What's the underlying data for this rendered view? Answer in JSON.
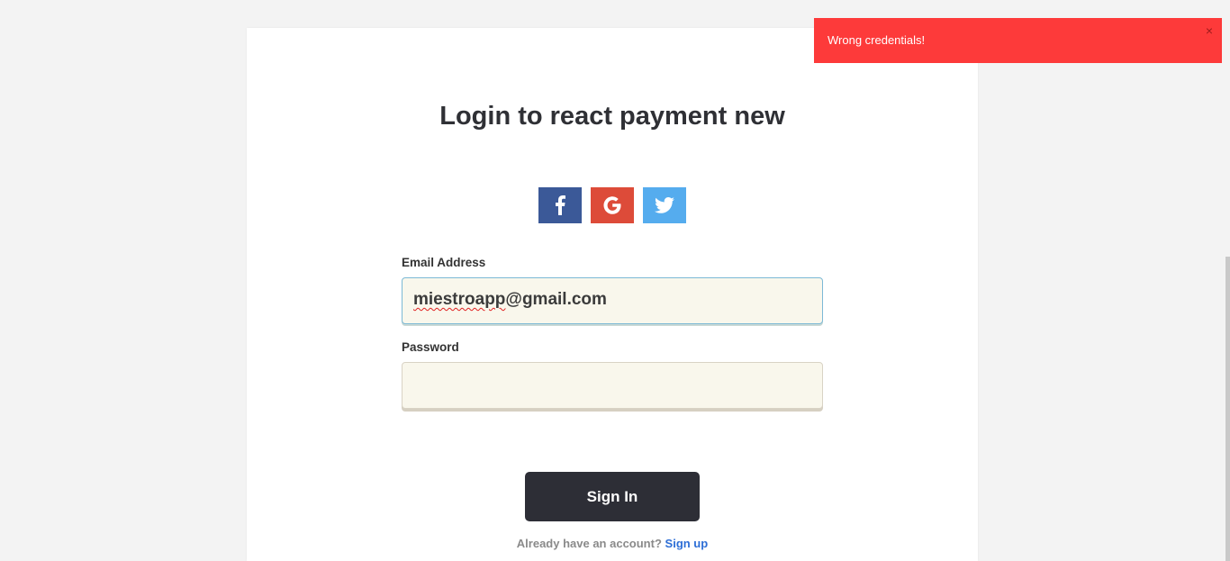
{
  "login": {
    "title": "Login to react payment new",
    "social": [
      {
        "icon": "facebook-icon",
        "color": "#3b5998"
      },
      {
        "icon": "google-icon",
        "color": "#dd4b39"
      },
      {
        "icon": "twitter-icon",
        "color": "#55acee"
      }
    ],
    "email": {
      "label": "Email Address",
      "value": "miestroapp@gmail.com",
      "value_part1": "miestroapp",
      "value_part2": "@gmail.com"
    },
    "password": {
      "label": "Password",
      "value": ""
    },
    "signin_label": "Sign In",
    "footer": {
      "prompt": "Already have an account?",
      "link": "Sign up"
    }
  },
  "toast": {
    "message": "Wrong credentials!",
    "close_glyph": "×",
    "color": "#fd3a3a"
  },
  "colors": {
    "page_bg": "#f3f3f3",
    "button_bg": "#2d2e36",
    "link": "#2d6ed6",
    "input_bg": "#f9f7ec"
  }
}
